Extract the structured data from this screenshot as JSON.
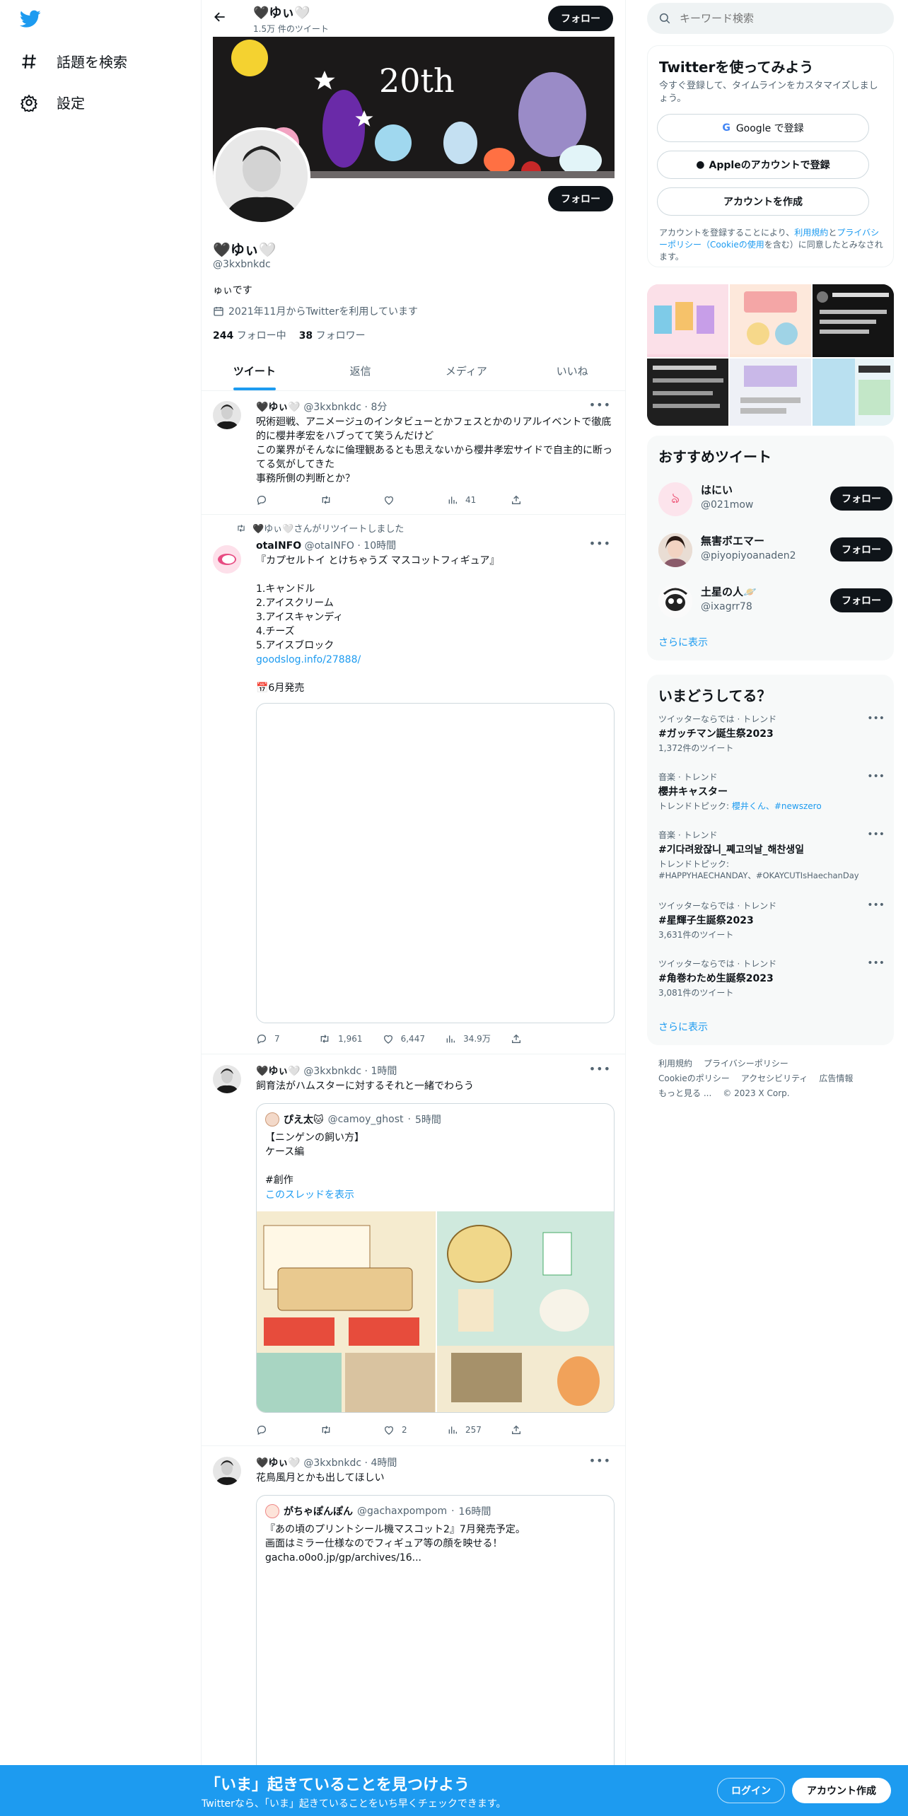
{
  "nav": {
    "explore": "話題を検索",
    "settings": "設定"
  },
  "header": {
    "name": "🖤ゆぃ🤍",
    "tweet_count": "1.5万 件のツイート",
    "follow": "フォロー"
  },
  "banner_art": {
    "text": "20th"
  },
  "profile": {
    "name": "🖤ゆぃ🤍",
    "handle": "@3kxbnkdc",
    "bio": "ゅぃです",
    "joined": "2021年11月からTwitterを利用しています",
    "following_count": "244",
    "following_label": "フォロー中",
    "followers_count": "38",
    "followers_label": "フォロワー",
    "follow": "フォロー"
  },
  "tabs": [
    "ツイート",
    "返信",
    "メディア",
    "いいね"
  ],
  "tweets": [
    {
      "name": "🖤ゆぃ🤍",
      "handle": "@3kxbnkdc",
      "time": "8分",
      "text": "呪術廻戦、アニメージュのインタビューとかフェスとかのリアルイベントで徹底的に櫻井孝宏をハブってて笑うんだけど\nこの業界がそんなに倫理観あるとも思えないから櫻井孝宏サイドで自主的に断ってる気がしてきた\n事務所側の判断とか？",
      "reply": "",
      "retweet": "",
      "like": "",
      "views": "41"
    },
    {
      "retweeted_by": "🖤ゆぃ🤍さんがリツイートしました",
      "name": "otaINFO",
      "handle": "@otaINFO",
      "time": "10時間",
      "text": "『カプセルトイ とけちゃうズ マスコットフィギュア』\n\n1.キャンドル\n2.アイスクリーム\n3.アイスキャンディ\n4.チーズ\n5.アイスブロック",
      "link": "goodslog.info/27888/",
      "release": "📅6月発売",
      "reply": "7",
      "retweet": "1,961",
      "like": "6,447",
      "views": "34.9万"
    },
    {
      "name": "🖤ゆぃ🤍",
      "handle": "@3kxbnkdc",
      "time": "1時間",
      "text": "飼育法がハムスターに対するそれと一緒でわらう",
      "quote": {
        "name": "ぴえ太🐱",
        "handle": "@camoy_ghost",
        "time": "5時間",
        "text": "【ニンゲンの飼い方】\nケース編\n\n#創作",
        "thread": "このスレッドを表示"
      },
      "reply": "",
      "retweet": "",
      "like": "2",
      "views": "257"
    },
    {
      "name": "🖤ゆぃ🤍",
      "handle": "@3kxbnkdc",
      "time": "4時間",
      "text": "花鳥風月とかも出してほしい",
      "quote": {
        "name": "がちゃぽんぽん",
        "handle": "@gachaxpompom",
        "time": "16時間",
        "text": "『あの頃のプリントシール機マスコット2』7月発売予定。\n画面はミラー仕様なのでフィギュア等の顔を映せる！\ngacha.o0o0.jp/gp/archives/16..."
      }
    }
  ],
  "search": {
    "placeholder": "キーワード検索"
  },
  "signup": {
    "title": "Twitterを使ってみよう",
    "subtitle": "今すぐ登録して、タイムラインをカスタマイズしましょう。",
    "google": "Google で登録",
    "apple": "Appleのアカウントで登録",
    "create": "アカウントを作成",
    "terms_1": "アカウントを登録することにより、",
    "terms_link1": "利用規約",
    "terms_2": "と",
    "terms_link2": "プライバシーポリシー（Cookieの使用",
    "terms_3": "を含む）に同意したとみなされます。"
  },
  "recommended": {
    "title": "おすすめツイート",
    "users": [
      {
        "name": "はにい",
        "handle": "@021mow",
        "follow": "フォロー"
      },
      {
        "name": "無害ボエマー",
        "handle": "@piyopiyoanaden2",
        "follow": "フォロー"
      },
      {
        "name": "土星の人🪐",
        "handle": "@ixagrr78",
        "follow": "フォロー"
      }
    ],
    "more": "さらに表示"
  },
  "trends": {
    "title": "いまどうしてる？",
    "items": [
      {
        "context": "ツイッターならでは · トレンド",
        "title": "#ガッチマン誕生祭2023",
        "sub": "1,372件のツイート"
      },
      {
        "context": "音楽 · トレンド",
        "title": "櫻井キャスター",
        "sub": "トレンドトピック: ",
        "sub_link": "櫻井くん、#newszero"
      },
      {
        "context": "音楽 · トレンド",
        "title": "#기다려왔잖니_쪠고의날_해찬생일",
        "sub": "トレンドトピック:",
        "sub_link": "#HAPPYHAECHANDAY、#OKAYCUTIsHaechanDay"
      },
      {
        "context": "ツイッターならでは · トレンド",
        "title": "#星輝子生誕祭2023",
        "sub": "3,631件のツイート"
      },
      {
        "context": "ツイッターならでは · トレンド",
        "title": "#角巻わため生誕祭2023",
        "sub": "3,081件のツイート"
      }
    ],
    "more": "さらに表示"
  },
  "footer": {
    "links": [
      "利用規約",
      "プライバシーポリシー",
      "Cookieのポリシー",
      "アクセシビリティ",
      "広告情報",
      "もっと見る ..."
    ],
    "copyright": "© 2023 X Corp."
  },
  "bottom_banner": {
    "title": "「いま」起きていることを見つけよう",
    "subtitle": "Twitterなら、「いま」起きていることをいち早くチェックできます。",
    "login": "ログイン",
    "signup": "アカウント作成"
  },
  "colors": {
    "accent": "#1d9bf0",
    "dark": "#0f1419",
    "muted": "#536471"
  }
}
